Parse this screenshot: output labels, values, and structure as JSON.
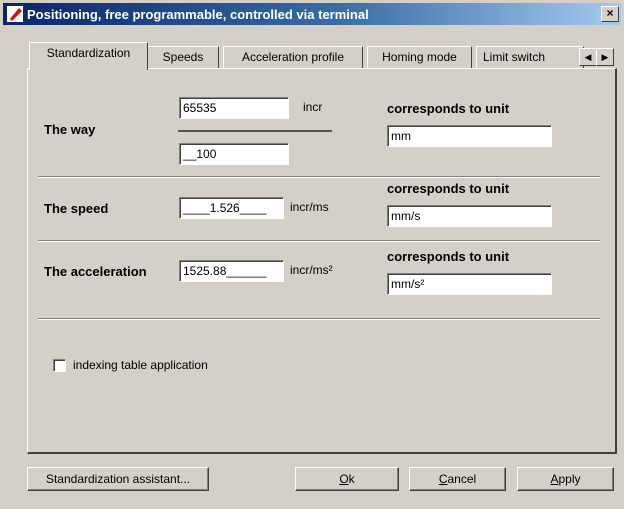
{
  "window": {
    "title": "Positioning, free programmable, controlled via terminal",
    "close_glyph": "×",
    "app_icon": "positioning-app-icon"
  },
  "tabs": [
    {
      "label": "Standardization"
    },
    {
      "label": "Speeds"
    },
    {
      "label": "Acceleration profile"
    },
    {
      "label": "Homing mode"
    },
    {
      "label": "Limit switch"
    }
  ],
  "tab_scroll": {
    "left": "◀",
    "right": "▶"
  },
  "way": {
    "label": "The way",
    "numerator": "65535",
    "denominator": "__100",
    "unit": "incr",
    "corresponds_label": "corresponds to unit",
    "unit_value": "mm"
  },
  "speed": {
    "label": "The speed",
    "value": "____1.526____",
    "unit": "incr/ms",
    "corresponds_label": "corresponds to unit",
    "unit_value": "mm/s"
  },
  "acceleration": {
    "label": "The acceleration",
    "value": "1525.88______",
    "unit": "incr/ms²",
    "corresponds_label": "corresponds to unit",
    "unit_value": "mm/s²"
  },
  "indexing": {
    "label": "indexing table application",
    "checked": false
  },
  "buttons": {
    "assistant": "Standardization assistant...",
    "ok_mnemonic": "O",
    "ok_rest": "k",
    "cancel_mnemonic": "C",
    "cancel_rest": "ancel",
    "apply_mnemonic": "A",
    "apply_rest": "pply"
  }
}
